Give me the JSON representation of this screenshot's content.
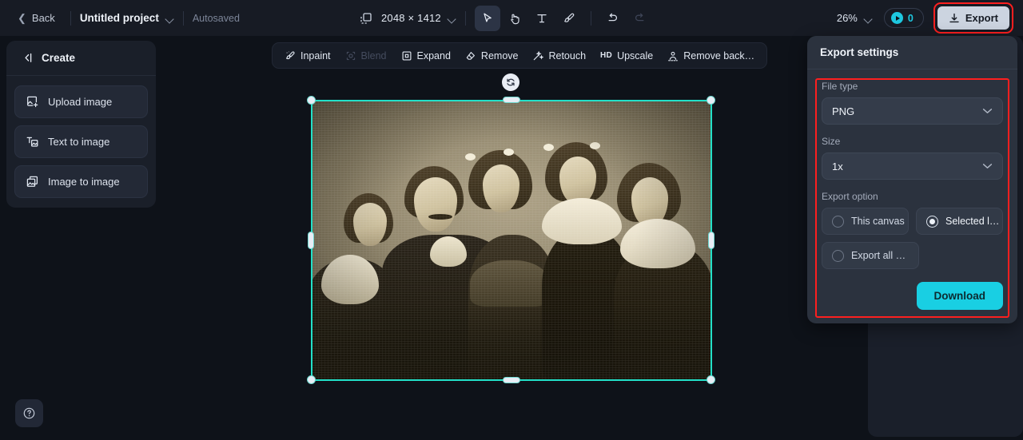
{
  "topbar": {
    "back_label": "Back",
    "project_name": "Untitled project",
    "autosaved_label": "Autosaved",
    "canvas_dimensions": "2048 × 1412",
    "zoom_level": "26%",
    "credits_count": "0",
    "export_label": "Export",
    "tools": [
      {
        "name": "select-tool",
        "icon": "cursor-icon",
        "active": true
      },
      {
        "name": "hand-tool",
        "icon": "hand-icon",
        "active": false
      },
      {
        "name": "text-tool",
        "icon": "text-icon",
        "active": false
      },
      {
        "name": "brush-tool",
        "icon": "brush-icon",
        "active": false
      },
      {
        "name": "undo",
        "icon": "undo-icon",
        "active": false
      },
      {
        "name": "redo",
        "icon": "redo-icon",
        "active": false
      }
    ]
  },
  "sidebar": {
    "header_label": "Create",
    "items": [
      {
        "label": "Upload image",
        "icon": "upload-image-icon"
      },
      {
        "label": "Text to image",
        "icon": "text-to-image-icon"
      },
      {
        "label": "Image to image",
        "icon": "image-to-image-icon"
      }
    ],
    "help_icon": "question-mark-icon"
  },
  "edit_toolbar": {
    "items": [
      {
        "label": "Inpaint",
        "icon": "inpaint-brush-icon",
        "disabled": false
      },
      {
        "label": "Blend",
        "icon": "blend-icon",
        "disabled": true
      },
      {
        "label": "Expand",
        "icon": "expand-icon",
        "disabled": false
      },
      {
        "label": "Remove",
        "icon": "eraser-icon",
        "disabled": false
      },
      {
        "label": "Retouch",
        "icon": "magic-wand-icon",
        "disabled": false
      },
      {
        "label": "Upscale",
        "icon": "hd-icon",
        "disabled": false
      },
      {
        "label": "Remove back…",
        "icon": "remove-background-icon",
        "disabled": false
      }
    ]
  },
  "canvas": {
    "rotate_icon": "rotate-icon",
    "selection_color": "#22e0c8",
    "image_description": "Vintage sepia family portrait of a man with moustache and four young women and girls"
  },
  "export_settings": {
    "title": "Export settings",
    "file_type": {
      "label": "File type",
      "value": "PNG"
    },
    "size": {
      "label": "Size",
      "value": "1x"
    },
    "export_option": {
      "label": "Export option",
      "options": [
        {
          "label": "This canvas",
          "selected": false
        },
        {
          "label": "Selected l…",
          "selected": true
        },
        {
          "label": "Export all …",
          "selected": false
        }
      ]
    },
    "download_label": "Download",
    "highlight_color": "#fd1f1f",
    "accent_color": "#19cfe3"
  }
}
